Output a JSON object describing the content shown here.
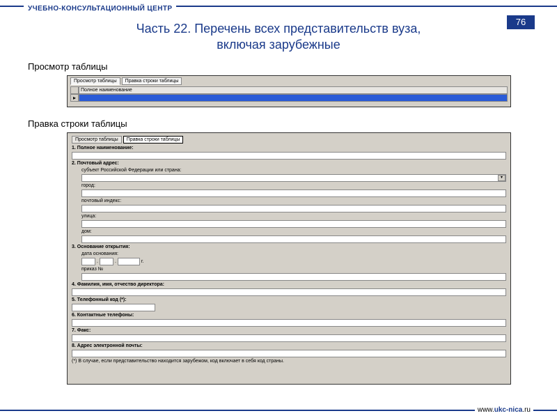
{
  "header": {
    "org_name": "УЧЕБНО-КОНСУЛЬТАЦИОННЫЙ ЦЕНТР",
    "page_number": "76"
  },
  "title": {
    "line1": "Часть 22. Перечень всех представительств вуза,",
    "line2": "включая зарубежные"
  },
  "sections": {
    "view_label": "Просмотр таблицы",
    "edit_label": "Правка строки таблицы"
  },
  "table_view": {
    "tabs": {
      "view": "Просмотр таблицы",
      "edit": "Правка строки таблицы"
    },
    "column_header": "Полное наименование",
    "row_marker": "▸"
  },
  "edit_panel": {
    "tabs": {
      "view": "Просмотр таблицы",
      "edit": "Правка строки таблицы"
    },
    "f1": "1. Полное наименование:",
    "f2": "2. Почтовый адрес:",
    "f2_sub": "субъект Российской Федерации или страна:",
    "f2_city": "город:",
    "f2_zip": "почтовый индекс:",
    "f2_street": "улица:",
    "f2_house": "дом:",
    "f3": "3. Основание открытия:",
    "f3_date": "дата основания:",
    "f3_year_suffix": "г.",
    "f3_order": "приказ №",
    "f4": "4. Фамилия, имя, отчество директора:",
    "f5": "5. Телефонный код (*):",
    "f6": "6. Контактные телефоны:",
    "f7": "7. Факс:",
    "f8": "8. Адрес электронной почты:",
    "footnote": "(*) В случае, если представительство находится зарубежом, код включает в себя код страны."
  },
  "footer": {
    "url_prefix": "www.",
    "url_main": "ukc-nica",
    "url_suffix": ".ru"
  }
}
